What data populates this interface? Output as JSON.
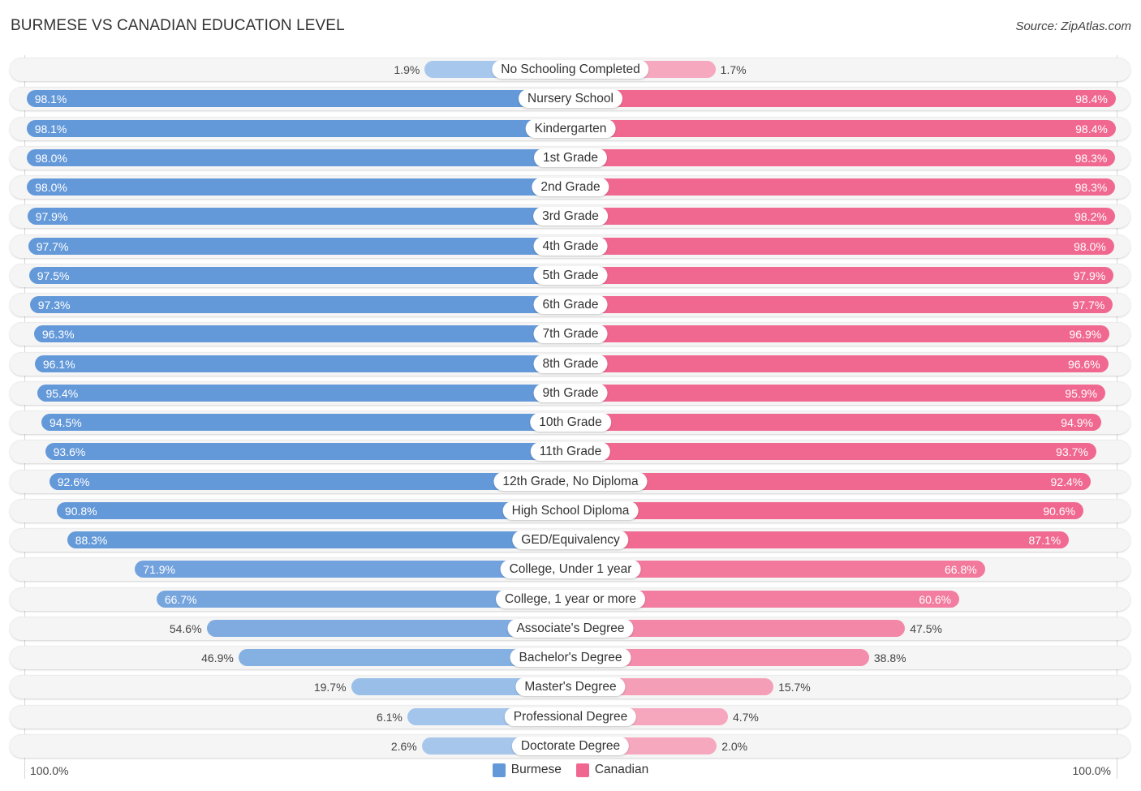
{
  "header": {
    "title": "BURMESE VS CANADIAN EDUCATION LEVEL",
    "source": "Source: ZipAtlas.com"
  },
  "axis": {
    "left_label": "100.0%",
    "right_label": "100.0%"
  },
  "legend": [
    {
      "name": "Burmese",
      "color": "#6499d9"
    },
    {
      "name": "Canadian",
      "color": "#f06890"
    }
  ],
  "colors": {
    "burmese_strong": "#6499d9",
    "burmese_light": "#a8c8ec",
    "canadian_strong": "#f06890",
    "canadian_light": "#f6a9c0"
  },
  "chart_data": {
    "type": "bar",
    "orientation": "horizontal-diverging",
    "title": "BURMESE VS CANADIAN EDUCATION LEVEL",
    "xlabel": "",
    "ylabel": "",
    "xlim": [
      0,
      100
    ],
    "legend_position": "bottom-center",
    "categories": [
      "No Schooling Completed",
      "Nursery School",
      "Kindergarten",
      "1st Grade",
      "2nd Grade",
      "3rd Grade",
      "4th Grade",
      "5th Grade",
      "6th Grade",
      "7th Grade",
      "8th Grade",
      "9th Grade",
      "10th Grade",
      "11th Grade",
      "12th Grade, No Diploma",
      "High School Diploma",
      "GED/Equivalency",
      "College, Under 1 year",
      "College, 1 year or more",
      "Associate's Degree",
      "Bachelor's Degree",
      "Master's Degree",
      "Professional Degree",
      "Doctorate Degree"
    ],
    "series": [
      {
        "name": "Burmese",
        "side": "left",
        "values": [
          1.9,
          98.1,
          98.1,
          98.0,
          98.0,
          97.9,
          97.7,
          97.5,
          97.3,
          96.3,
          96.1,
          95.4,
          94.5,
          93.6,
          92.6,
          90.8,
          88.3,
          71.9,
          66.7,
          54.6,
          46.9,
          19.7,
          6.1,
          2.6
        ],
        "labels": [
          "1.9%",
          "98.1%",
          "98.1%",
          "98.0%",
          "98.0%",
          "97.9%",
          "97.7%",
          "97.5%",
          "97.3%",
          "96.3%",
          "96.1%",
          "95.4%",
          "94.5%",
          "93.6%",
          "92.6%",
          "90.8%",
          "88.3%",
          "71.9%",
          "66.7%",
          "54.6%",
          "46.9%",
          "19.7%",
          "6.1%",
          "2.6%"
        ]
      },
      {
        "name": "Canadian",
        "side": "right",
        "values": [
          1.7,
          98.4,
          98.4,
          98.3,
          98.3,
          98.2,
          98.0,
          97.9,
          97.7,
          96.9,
          96.6,
          95.9,
          94.9,
          93.7,
          92.4,
          90.6,
          87.1,
          66.8,
          60.6,
          47.5,
          38.8,
          15.7,
          4.7,
          2.0
        ],
        "labels": [
          "1.7%",
          "98.4%",
          "98.4%",
          "98.3%",
          "98.3%",
          "98.2%",
          "98.0%",
          "97.9%",
          "97.7%",
          "96.9%",
          "96.6%",
          "95.9%",
          "94.9%",
          "93.7%",
          "92.4%",
          "90.6%",
          "87.1%",
          "66.8%",
          "60.6%",
          "47.5%",
          "38.8%",
          "15.7%",
          "4.7%",
          "2.0%"
        ]
      }
    ]
  }
}
